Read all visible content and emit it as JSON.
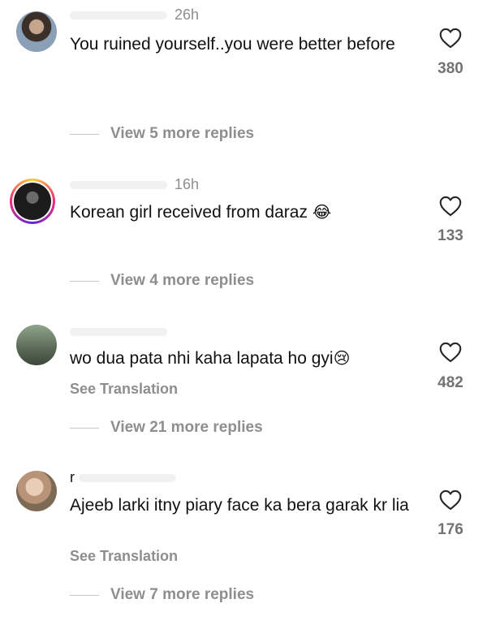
{
  "comments": [
    {
      "username": "",
      "time": "26h",
      "text": "You ruined yourself..you were better before",
      "likes": "380",
      "replies_label": "View 5 more replies",
      "see_translation": ""
    },
    {
      "username": "",
      "time": "16h",
      "text": "Korean girl received from daraz ",
      "emoji": "😂",
      "likes": "133",
      "replies_label": "View 4 more replies",
      "see_translation": ""
    },
    {
      "username": "",
      "time": "",
      "text": "wo dua pata nhi kaha lapata ho gyi",
      "emoji": "😢",
      "likes": "482",
      "replies_label": "View 21 more replies",
      "see_translation": "See Translation"
    },
    {
      "username": "r",
      "time": "",
      "text": "Ajeeb larki itny piary face ka bera garak kr lia",
      "likes": "176",
      "replies_label": "View 7 more replies",
      "see_translation": "See Translation"
    }
  ],
  "icons": {
    "like": "heart-outline-icon"
  },
  "colors": {
    "text": "#111111",
    "muted": "#8e8e8e",
    "likes": "#737373"
  }
}
